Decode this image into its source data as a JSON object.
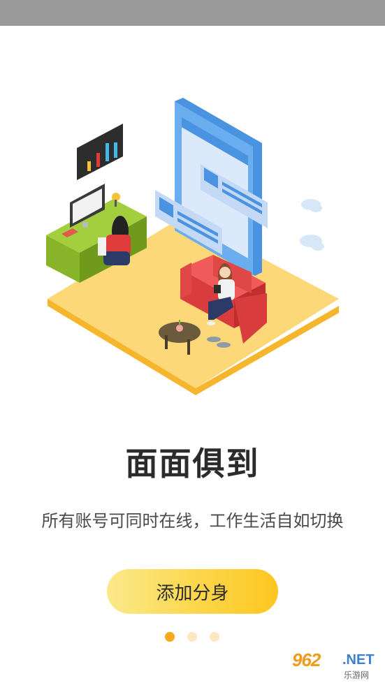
{
  "onboarding": {
    "title": "面面俱到",
    "subtitle": "所有账号可同时在线，工作生活自如切换",
    "cta_label": "添加分身",
    "page_indicator": {
      "total": 3,
      "active": 1
    }
  },
  "watermark": {
    "main": "962",
    "net": ".NET",
    "sub": "乐游网"
  },
  "colors": {
    "accent": "#fdc61f",
    "dot_active": "#f7a81b",
    "dot_inactive": "#fbe8bb",
    "status_bar": "#9a9a9a"
  },
  "icons": {
    "hero": "multi-account-illustration"
  }
}
